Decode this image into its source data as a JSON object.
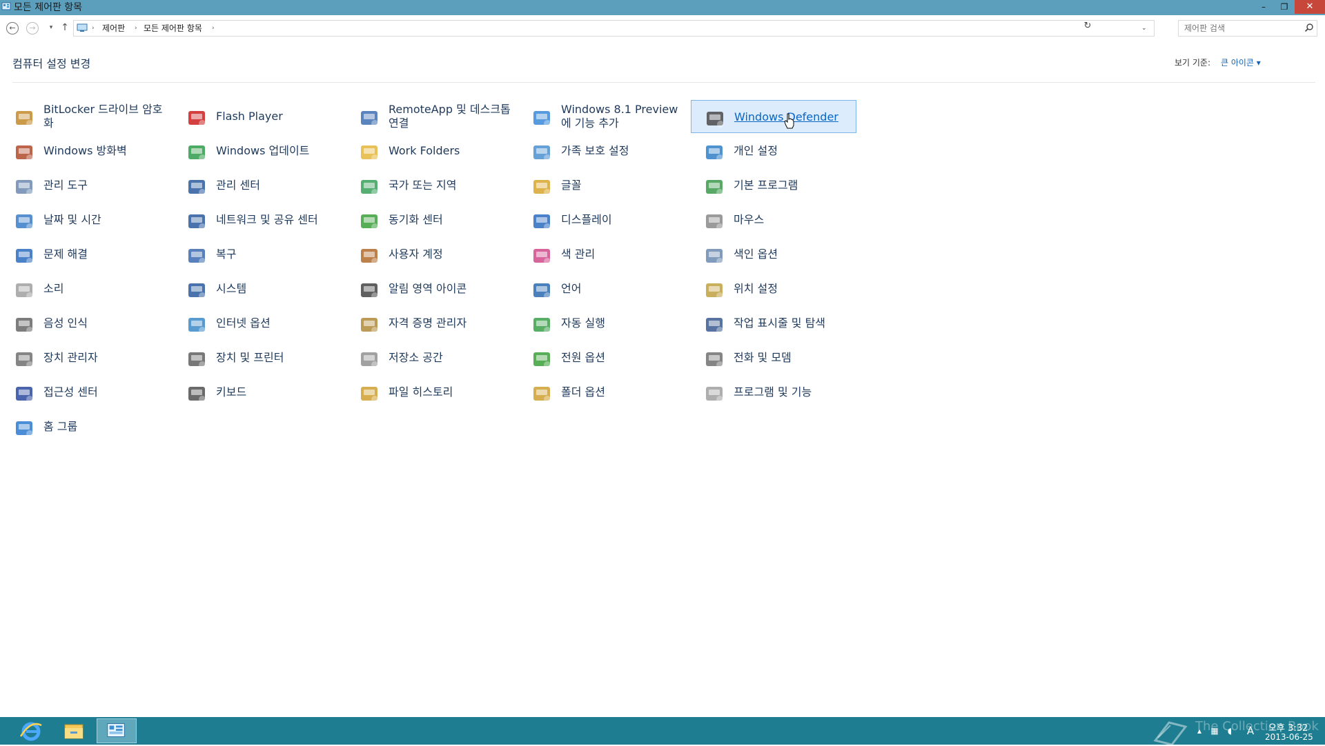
{
  "window": {
    "title": "모든 제어판 항목",
    "controls": {
      "minimize": "–",
      "maximize": "❐",
      "close": "✕"
    }
  },
  "nav": {
    "back": "←",
    "forward": "→",
    "recent": "▾",
    "up": "↑",
    "breadcrumbs": [
      "제어판",
      "모든 제어판 항목"
    ],
    "separator": "›",
    "dropdown": "⌄",
    "refresh": "↻",
    "search_placeholder": "제어판 검색"
  },
  "header": {
    "title": "컴퓨터 설정 변경",
    "view_by_label": "보기 기준:",
    "view_by_value": "큰 아이콘 ▾"
  },
  "items": [
    {
      "label": "BitLocker 드라이브 암호화",
      "icon": "bitlocker-icon"
    },
    {
      "label": "Flash Player",
      "icon": "flash-icon"
    },
    {
      "label": "RemoteApp 및 데스크톱 연결",
      "icon": "remoteapp-icon"
    },
    {
      "label": "Windows 8.1 Preview에 기능 추가",
      "icon": "add-features-icon"
    },
    {
      "label": "Windows Defender",
      "icon": "defender-icon"
    },
    {
      "label": "Windows 방화벽",
      "icon": "firewall-icon"
    },
    {
      "label": "Windows 업데이트",
      "icon": "update-icon"
    },
    {
      "label": "Work Folders",
      "icon": "work-folders-icon"
    },
    {
      "label": "가족 보호 설정",
      "icon": "family-safety-icon"
    },
    {
      "label": "개인 설정",
      "icon": "personalization-icon"
    },
    {
      "label": "관리 도구",
      "icon": "admin-tools-icon"
    },
    {
      "label": "관리 센터",
      "icon": "action-center-icon"
    },
    {
      "label": "국가 또는 지역",
      "icon": "region-icon"
    },
    {
      "label": "글꼴",
      "icon": "fonts-icon"
    },
    {
      "label": "기본 프로그램",
      "icon": "default-programs-icon"
    },
    {
      "label": "날짜 및 시간",
      "icon": "date-time-icon"
    },
    {
      "label": "네트워크 및 공유 센터",
      "icon": "network-icon"
    },
    {
      "label": "동기화 센터",
      "icon": "sync-icon"
    },
    {
      "label": "디스플레이",
      "icon": "display-icon"
    },
    {
      "label": "마우스",
      "icon": "mouse-icon"
    },
    {
      "label": "문제 해결",
      "icon": "troubleshoot-icon"
    },
    {
      "label": "복구",
      "icon": "recovery-icon"
    },
    {
      "label": "사용자 계정",
      "icon": "user-accounts-icon"
    },
    {
      "label": "색 관리",
      "icon": "color-management-icon"
    },
    {
      "label": "색인 옵션",
      "icon": "indexing-icon"
    },
    {
      "label": "소리",
      "icon": "sound-icon"
    },
    {
      "label": "시스템",
      "icon": "system-icon"
    },
    {
      "label": "알림 영역 아이콘",
      "icon": "notification-icons-icon"
    },
    {
      "label": "언어",
      "icon": "language-icon"
    },
    {
      "label": "위치 설정",
      "icon": "location-icon"
    },
    {
      "label": "음성 인식",
      "icon": "speech-icon"
    },
    {
      "label": "인터넷 옵션",
      "icon": "internet-options-icon"
    },
    {
      "label": "자격 증명 관리자",
      "icon": "credential-icon"
    },
    {
      "label": "자동 실행",
      "icon": "autoplay-icon"
    },
    {
      "label": "작업 표시줄 및 탐색",
      "icon": "taskbar-nav-icon"
    },
    {
      "label": "장치 관리자",
      "icon": "device-manager-icon"
    },
    {
      "label": "장치 및 프린터",
      "icon": "devices-printers-icon"
    },
    {
      "label": "저장소 공간",
      "icon": "storage-spaces-icon"
    },
    {
      "label": "전원 옵션",
      "icon": "power-icon"
    },
    {
      "label": "전화 및 모뎀",
      "icon": "phone-modem-icon"
    },
    {
      "label": "접근성 센터",
      "icon": "ease-of-access-icon"
    },
    {
      "label": "키보드",
      "icon": "keyboard-icon"
    },
    {
      "label": "파일 히스토리",
      "icon": "file-history-icon"
    },
    {
      "label": "폴더 옵션",
      "icon": "folder-options-icon"
    },
    {
      "label": "프로그램 및 기능",
      "icon": "programs-features-icon"
    },
    {
      "label": "홈 그룹",
      "icon": "homegroup-icon"
    }
  ],
  "hovered_item": "Windows Defender",
  "taskbar": {
    "apps": [
      "internet-explorer-icon",
      "file-explorer-icon",
      "control-panel-icon"
    ],
    "tray": {
      "ime": "A"
    },
    "clock_time": "오후 3:32",
    "clock_date": "2013-06-25",
    "watermark": "The Collection Book"
  }
}
